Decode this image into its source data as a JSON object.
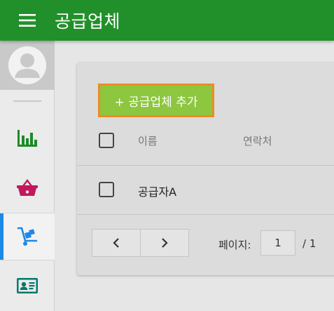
{
  "header": {
    "title": "공급업체",
    "menu_icon": "hamburger-menu-icon"
  },
  "sidebar": {
    "avatar_icon": "user-avatar-icon",
    "items": [
      {
        "icon": "bar-chart-icon",
        "color": "#1e8a2a",
        "active": false
      },
      {
        "icon": "shopping-basket-icon",
        "color": "#c2185b",
        "active": false
      },
      {
        "icon": "hand-truck-icon",
        "color": "#1e88e5",
        "active": true
      },
      {
        "icon": "id-card-icon",
        "color": "#00796b",
        "active": false
      }
    ]
  },
  "main": {
    "add_button_label": "+ 공급업체 추가",
    "table": {
      "columns": [
        "이름",
        "연락처"
      ],
      "rows": [
        {
          "name": "공급자A",
          "contact": ""
        }
      ]
    },
    "pagination": {
      "prev_icon": "chevron-left-icon",
      "next_icon": "chevron-right-icon",
      "page_label": "페이지:",
      "current_page": "1",
      "total_label": "/ 1"
    }
  },
  "colors": {
    "header_green": "#22902a",
    "add_button_green": "#8dc63f",
    "add_button_border": "#f08a24",
    "active_indicator": "#1e88e5"
  }
}
